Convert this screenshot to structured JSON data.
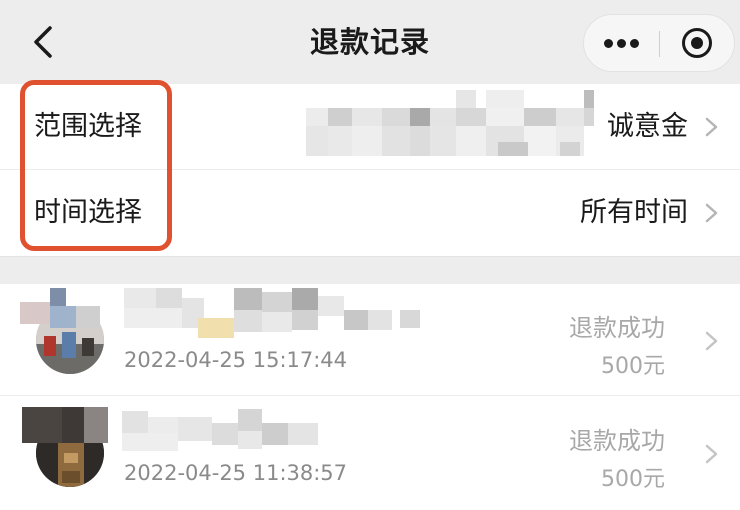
{
  "navbar": {
    "title": "退款记录",
    "icons": {
      "back": "chevron-left-icon",
      "more": "more-dots-icon",
      "close": "mini-program-close-icon"
    }
  },
  "filters": [
    {
      "label": "范围选择",
      "value": "诚意金"
    },
    {
      "label": "时间选择",
      "value": "所有时间"
    }
  ],
  "records": [
    {
      "datetime": "2022-04-25 15:17:44",
      "status": "退款成功",
      "amount": "500元"
    },
    {
      "datetime": "2022-04-25 11:38:57",
      "status": "退款成功",
      "amount": "500元"
    }
  ],
  "colors": {
    "highlight_box": "#e0522f",
    "navbar_bg": "#ededed",
    "muted_text": "#a8a8a8"
  }
}
